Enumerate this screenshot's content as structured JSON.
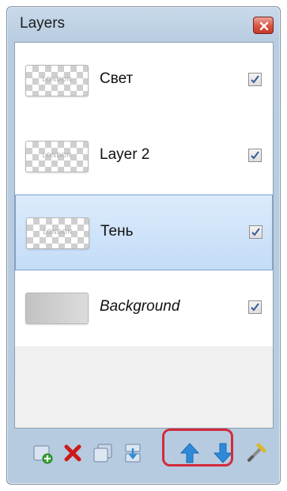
{
  "window": {
    "title": "Layers",
    "close_icon": "close-icon"
  },
  "layers": [
    {
      "name": "Свет",
      "thumb_text": "LONDON",
      "visible": true,
      "selected": false,
      "italic": false,
      "thumb": "checkerboard"
    },
    {
      "name": "Layer 2",
      "thumb_text": "LONDON",
      "visible": true,
      "selected": false,
      "italic": false,
      "thumb": "checkerboard"
    },
    {
      "name": "Тень",
      "thumb_text": "LONDON",
      "visible": true,
      "selected": true,
      "italic": false,
      "thumb": "checkerboard"
    },
    {
      "name": "Background",
      "thumb_text": "",
      "visible": true,
      "selected": false,
      "italic": true,
      "thumb": "gray-gradient"
    }
  ],
  "toolbar": {
    "buttons": [
      {
        "icon": "add-layer-icon"
      },
      {
        "icon": "delete-layer-icon"
      },
      {
        "icon": "duplicate-layer-icon"
      },
      {
        "icon": "merge-down-icon"
      },
      {
        "icon": "move-up-icon"
      },
      {
        "icon": "move-down-icon"
      },
      {
        "icon": "properties-icon"
      }
    ],
    "highlighted": [
      "move-up-icon",
      "move-down-icon"
    ],
    "highlight_color": "#d32b3c"
  },
  "colors": {
    "selection_top": "#dcebfb",
    "selection_bottom": "#c4dcf7",
    "arrow_blue": "#2e8ad8",
    "delete_red": "#cc1a1a"
  }
}
